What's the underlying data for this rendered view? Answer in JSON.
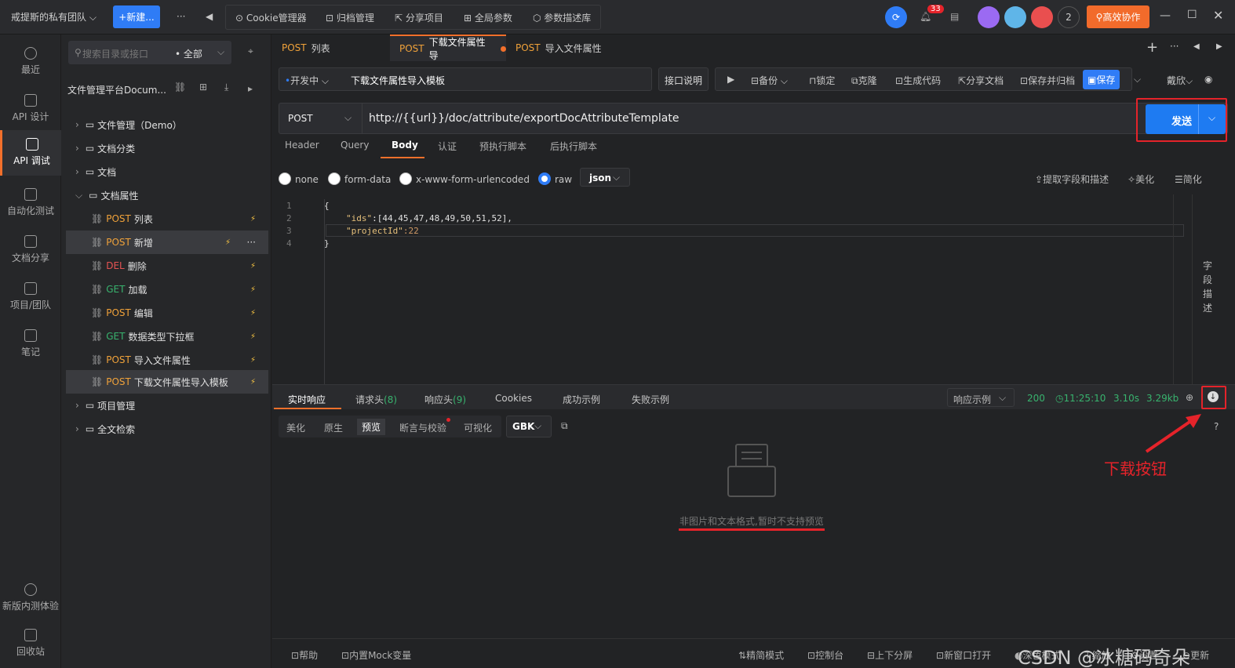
{
  "topbar": {
    "team": "戒提斯的私有团队",
    "new_label": "+新建...",
    "more": "···",
    "tools": [
      "Cookie管理器",
      "归档管理",
      "分享项目",
      "全局参数",
      "参数描述库"
    ],
    "notification_count": "33",
    "member_count": "2",
    "collab_label": "高效协作"
  },
  "leftnav": {
    "items": [
      "最近",
      "API 设计",
      "API 调试",
      "自动化测试",
      "文档分享",
      "项目/团队",
      "笔记"
    ],
    "bottom": [
      "新版内测体验",
      "回收站"
    ]
  },
  "tree": {
    "search_placeholder": "搜索目录或接口",
    "filter": "全部",
    "project": "文件管理平台Docum...",
    "folders_top": [
      "文件管理（Demo）",
      "文档分类",
      "文档",
      "文档属性"
    ],
    "items": [
      {
        "method": "POST",
        "name": "列表",
        "cls": "m-post"
      },
      {
        "method": "POST",
        "name": "新增",
        "cls": "m-post"
      },
      {
        "method": "DEL",
        "name": "删除",
        "cls": "m-del"
      },
      {
        "method": "GET",
        "name": "加载",
        "cls": "m-get"
      },
      {
        "method": "POST",
        "name": "编辑",
        "cls": "m-post"
      },
      {
        "method": "GET",
        "name": "数据类型下拉框",
        "cls": "m-get"
      },
      {
        "method": "POST",
        "name": "导入文件属性",
        "cls": "m-post"
      },
      {
        "method": "POST",
        "name": "下载文件属性导入模板",
        "cls": "m-post"
      }
    ],
    "folders_bottom": [
      "项目管理",
      "全文检索"
    ]
  },
  "tabs": [
    {
      "method": "POST",
      "name": "列表"
    },
    {
      "method": "POST",
      "name": "下载文件属性导"
    },
    {
      "method": "POST",
      "name": "导入文件属性"
    }
  ],
  "request": {
    "status": "开发中",
    "name": "下载文件属性导入模板",
    "doc_btn": "接口说明",
    "actions": [
      "备份",
      "锁定",
      "克隆",
      "生成代码",
      "分享文档",
      "保存并归档"
    ],
    "save": "保存",
    "user": "戴欣",
    "method": "POST",
    "url": "http://{{url}}/doc/attribute/exportDocAttributeTemplate",
    "send": "发送",
    "subtabs": [
      "Header",
      "Query",
      "Body",
      "认证",
      "预执行脚本",
      "后执行脚本"
    ],
    "radios": [
      "none",
      "form-data",
      "x-www-form-urlencoded",
      "raw"
    ],
    "format": "json",
    "right_tools": [
      "提取字段和描述",
      "美化",
      "简化"
    ],
    "side_label": [
      "字",
      "段",
      "描",
      "述"
    ],
    "code_line_numbers": [
      "1",
      "2",
      "3",
      "4"
    ],
    "code": {
      "l1": "{",
      "l2_key": "\"ids\"",
      "l2_val": ":[44,45,47,48,49,50,51,52],",
      "l3_key": "\"projectId\"",
      "l3_val": ":22",
      "l4": "}"
    }
  },
  "response": {
    "tabs": [
      "实时响应",
      "请求头",
      "(8)",
      "响应头",
      "(9)",
      "Cookies",
      "成功示例",
      "失败示例"
    ],
    "example": "响应示例",
    "code": "200",
    "time": "11:25:10",
    "duration": "3.10s",
    "size": "3.29kb",
    "view_tabs": [
      "美化",
      "原生",
      "预览",
      "断言与校验",
      "可视化"
    ],
    "encoding": "GBK",
    "help": "?",
    "empty_message": "非图片和文本格式,暂时不支持预览",
    "annotation": "下载按钮"
  },
  "statusbar": [
    "帮助",
    "内置Mock变量",
    "精简模式",
    "控制台",
    "上下分屏",
    "新窗口打开",
    "深色模式",
    "缩放",
    "设置",
    "更新"
  ],
  "watermark": "CSDN @冰糖码奇朵"
}
